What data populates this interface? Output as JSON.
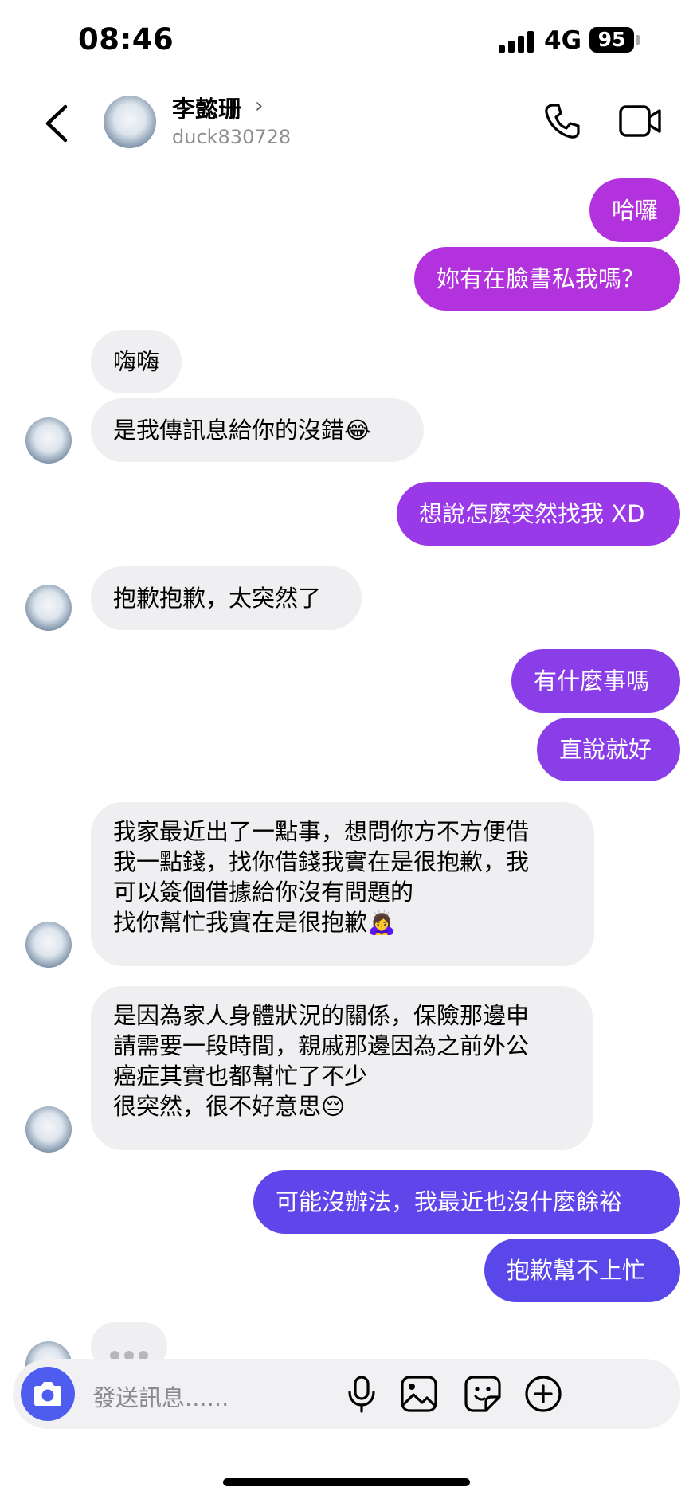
{
  "status_bar": {
    "time": "08:46",
    "network": "4G",
    "battery": "95"
  },
  "header": {
    "contact_name": "李懿珊",
    "chevron": "›",
    "username": "duck830728"
  },
  "messages": [
    {
      "side": "out",
      "text": "哈囉",
      "color": "#b232de"
    },
    {
      "side": "out",
      "text": "妳有在臉書私我嗎？",
      "color": "#b232de"
    },
    {
      "side": "in",
      "text": "嗨嗨"
    },
    {
      "side": "in",
      "text": "是我傳訊息給你的沒錯",
      "emoji": "😂"
    },
    {
      "side": "out",
      "text": "想說怎麼突然找我 XD",
      "color": "#9a39e8"
    },
    {
      "side": "in",
      "text": "抱歉抱歉，太突然了"
    },
    {
      "side": "out",
      "text": "有什麼事嗎",
      "color": "#8a3ee8"
    },
    {
      "side": "out",
      "text": "直說就好",
      "color": "#8a3ee8"
    },
    {
      "side": "in",
      "lines": [
        "我家最近出了一點事，想問你方不方便借",
        "我一點錢，找你借錢我實在是很抱歉，我",
        "可以簽個借據給你沒有問題的",
        "找你幫忙我實在是很抱歉"
      ],
      "emoji": "🙇‍♀️"
    },
    {
      "side": "in",
      "lines": [
        "是因為家人身體狀況的關係，保險那邊申",
        "請需要一段時間，親戚那邊因為之前外公",
        "癌症其實也都幫忙了不少",
        "很突然，很不好意思"
      ],
      "emoji": "😔"
    },
    {
      "side": "out",
      "text": "可能沒辦法，我最近也沒什麼餘裕",
      "color": "#6046ea"
    },
    {
      "side": "out",
      "text": "抱歉幫不上忙",
      "color": "#5a47ea"
    }
  ],
  "composer": {
    "placeholder": "發送訊息......"
  },
  "colors": {
    "accent": "#4e5df0",
    "incoming_bubble": "#efeff1"
  },
  "icons": [
    "back-arrow-icon",
    "phone-icon",
    "video-camera-icon",
    "camera-icon",
    "microphone-icon",
    "image-icon",
    "sticker-icon",
    "plus-icon"
  ]
}
